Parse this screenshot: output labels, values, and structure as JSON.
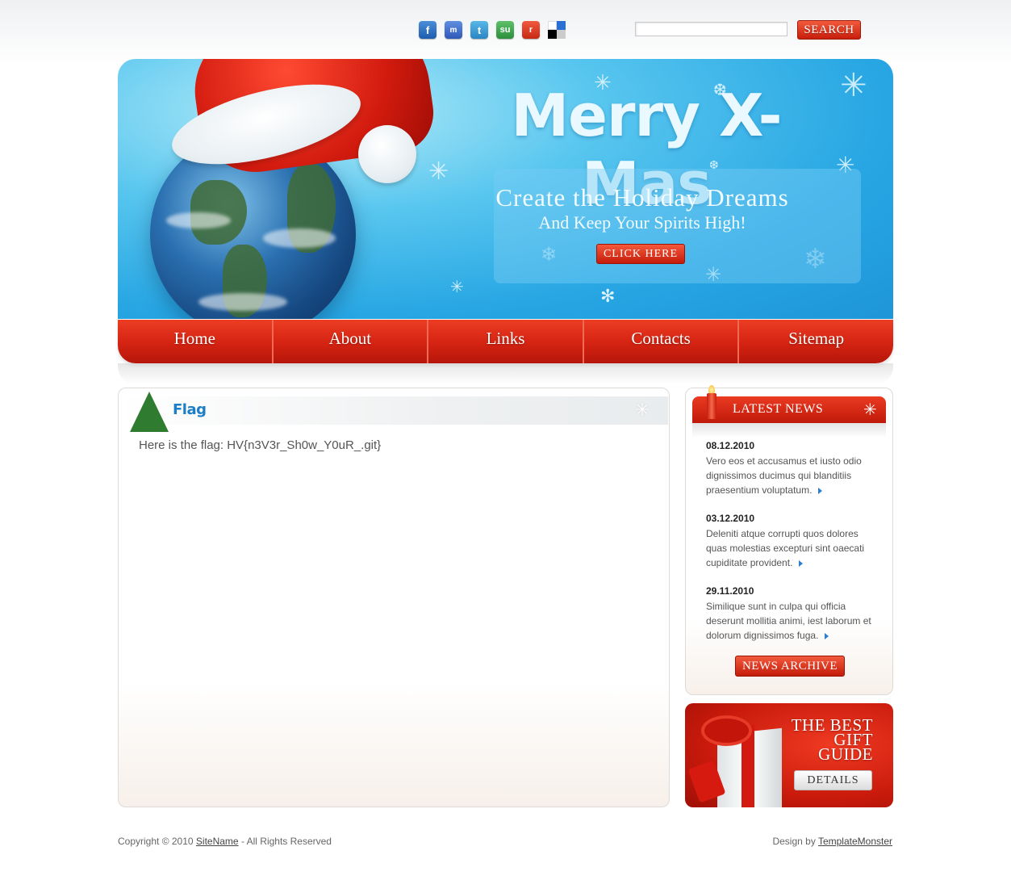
{
  "social": {
    "icons": [
      "facebook-icon",
      "myspace-icon",
      "twitter-icon",
      "stumbleupon-icon",
      "reddit-icon",
      "delicious-icon"
    ],
    "glyphs": [
      "f",
      "m",
      "t",
      "su",
      "r",
      ""
    ]
  },
  "search": {
    "value": "",
    "placeholder": "",
    "button_label": "SEARCH"
  },
  "banner": {
    "title": "Merry X-Mas",
    "subtitle_line1": "Create the Holiday Dreams",
    "subtitle_line2": "And Keep Your Spirits High!",
    "button_label": "CLICK HERE"
  },
  "nav": {
    "items": [
      "Home",
      "About",
      "Links",
      "Contacts",
      "Sitemap"
    ]
  },
  "content": {
    "title": "Flag",
    "body": "Here is the flag: HV{n3V3r_Sh0w_Y0uR_.git}"
  },
  "news": {
    "title": "LATEST NEWS",
    "items": [
      {
        "date": "08.12.2010",
        "text": "Vero eos et accusamus et iusto odio dignissimos ducimus qui blanditiis praesentium voluptatum."
      },
      {
        "date": "03.12.2010",
        "text": "Deleniti atque corrupti quos dolores quas molestias excepturi sint oaecati cupiditate provident."
      },
      {
        "date": "29.11.2010",
        "text": "Similique sunt in culpa qui officia deserunt mollitia animi, iest laborum et dolorum dignissimos fuga."
      }
    ],
    "archive_label": "NEWS ARCHIVE"
  },
  "gift": {
    "line1": "THE BEST",
    "line2": "GIFT",
    "line3": "GUIDE",
    "button_label": "DETAILS"
  },
  "footer": {
    "copyright_prefix": "Copyright © 2010",
    "site_link": "SiteName",
    "rights": "- All Rights Reserved",
    "design_prefix": "Design by",
    "designer_link": "TemplateMonster"
  },
  "colors": {
    "accent_red": "#d42312",
    "banner_blue": "#27a6e3",
    "title_blue": "#1c7fc6"
  }
}
